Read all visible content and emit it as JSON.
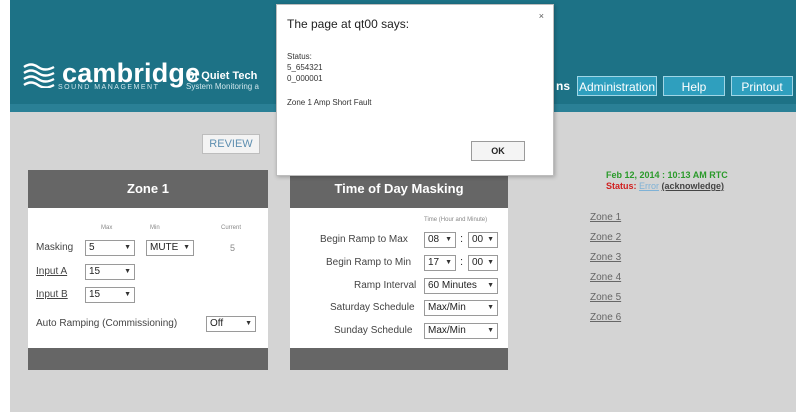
{
  "brand": {
    "logo_text": "cambridge",
    "logo_sub": "SOUND MANAGEMENT",
    "product_name": "Qt Quiet Tech",
    "product_sub": "System Monitoring a"
  },
  "nav": {
    "partial_label": "ns",
    "tabs": [
      "Administration",
      "Help",
      "Printout"
    ]
  },
  "review_label": "REVIEW",
  "zone_panel": {
    "title": "Zone 1",
    "col_max": "Max",
    "col_min": "Min",
    "col_current": "Current",
    "masking_label": "Masking",
    "masking_max": "5",
    "masking_min": "MUTE",
    "masking_current": "5",
    "input_a_label": "Input A",
    "input_a_value": "15",
    "input_b_label": "Input B",
    "input_b_value": "15",
    "auto_ramping_label": "Auto Ramping (Commissioning)",
    "auto_ramping_value": "Off"
  },
  "tod_panel": {
    "title": "Time of Day Masking",
    "col_time": "Time (Hour and Minute)",
    "begin_max_label": "Begin Ramp to Max",
    "begin_max_hour": "08",
    "begin_max_min": "00",
    "begin_min_label": "Begin Ramp to Min",
    "begin_min_hour": "17",
    "begin_min_min": "00",
    "ramp_interval_label": "Ramp Interval",
    "ramp_interval_value": "60 Minutes",
    "saturday_label": "Saturday Schedule",
    "saturday_value": "Max/Min",
    "sunday_label": "Sunday Schedule",
    "sunday_value": "Max/Min"
  },
  "status_area": {
    "rtc": "Feb 12, 2014 : 10:13 AM RTC",
    "status_prefix": "Status:",
    "status_error": "Error",
    "acknowledge": "(acknowledge)"
  },
  "zones": [
    "Zone 1",
    "Zone 2",
    "Zone 3",
    "Zone 4",
    "Zone 5",
    "Zone 6"
  ],
  "dialog": {
    "title": "The page at qt00 says:",
    "close": "×",
    "line1": "Status:",
    "line2": "5_654321",
    "line3": "0_000001",
    "message": "Zone 1 Amp Short Fault",
    "ok": "OK"
  },
  "colors": {
    "header": "#1d7286",
    "panel_head": "#666666",
    "nav_tab": "#2f9fbe",
    "rtc": "#2a9a2a",
    "status": "#d02020"
  }
}
